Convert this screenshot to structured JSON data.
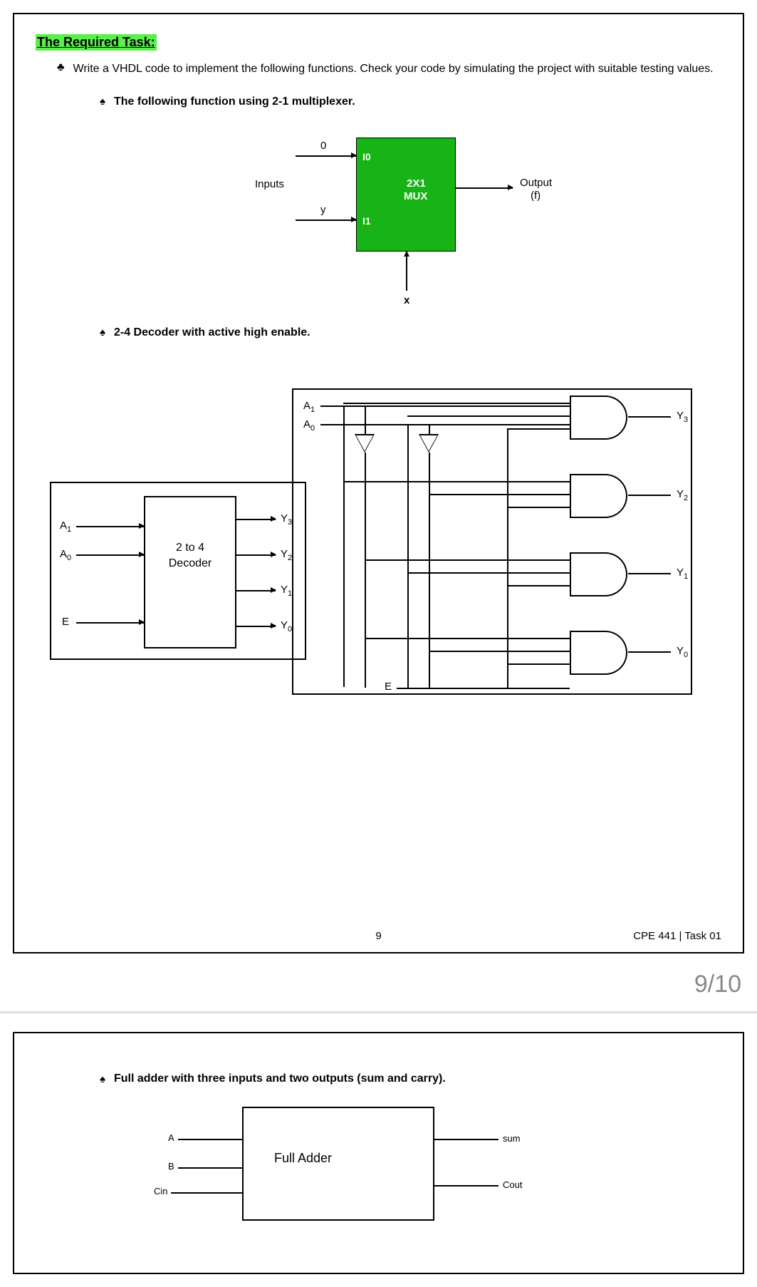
{
  "header": {
    "title": "The Required Task:"
  },
  "intro": "Write a VHDL code to implement the following functions. Check your code by simulating the project with suitable testing values.",
  "sections": {
    "mux": {
      "heading": "The following function using 2-1 multiplexer.",
      "labels": {
        "inputs": "Inputs",
        "in0": "0",
        "in1": "y",
        "i0": "I0",
        "i1": "I1",
        "title1": "2X1",
        "title2": "MUX",
        "sel": "x",
        "out": "Output",
        "outf": "(f)"
      }
    },
    "decoder": {
      "heading": "2-4 Decoder with active high enable.",
      "block": {
        "line1": "2 to 4",
        "line2": "Decoder",
        "inA1": "A",
        "inA1s": "1",
        "inA0": "A",
        "inA0s": "0",
        "inE": "E",
        "y3": "Y",
        "y3s": "3",
        "y2": "Y",
        "y2s": "2",
        "y1": "Y",
        "y1s": "1",
        "y0": "Y",
        "y0s": "0"
      },
      "schem": {
        "A1": "A",
        "A1s": "1",
        "A0": "A",
        "A0s": "0",
        "E": "E",
        "Y3": "Y",
        "Y3s": "3",
        "Y2": "Y",
        "Y2s": "2",
        "Y1": "Y",
        "Y1s": "1",
        "Y0": "Y",
        "Y0s": "0"
      }
    },
    "fulladder": {
      "heading": "Full adder with three inputs and two outputs (sum and carry).",
      "labels": {
        "A": "A",
        "B": "B",
        "Cin": "Cin",
        "title": "Full Adder",
        "sum": "sum",
        "cout": "Cout"
      }
    }
  },
  "footer": {
    "pagenum_center": "9",
    "course": "CPE 441 | Task 01",
    "bigpage": "9/10"
  }
}
